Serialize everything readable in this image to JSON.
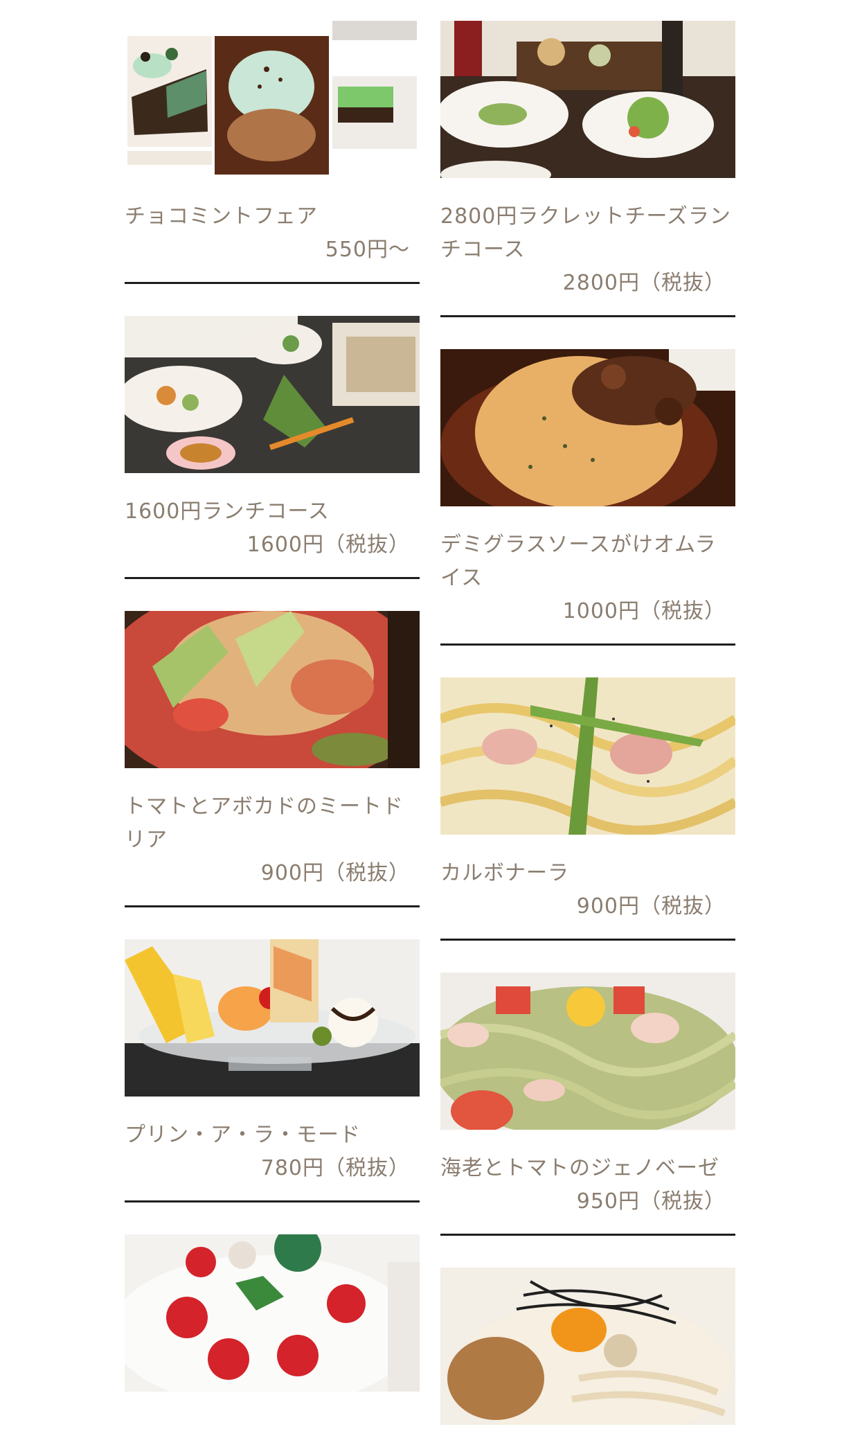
{
  "menu": {
    "left": [
      {
        "name": "チョコミントフェア",
        "price": "550円〜",
        "image_icon": "chocomint-desserts-photo"
      },
      {
        "name": "1600円ランチコース",
        "price": "1600円（税抜）",
        "image_icon": "lunch-course-photo"
      },
      {
        "name": "トマトとアボカドのミートドリア",
        "price": "900円（税抜）",
        "image_icon": "meat-doria-photo"
      },
      {
        "name": "プリン・ア・ラ・モード",
        "price": "780円（税抜）",
        "image_icon": "pudding-a-la-mode-photo"
      },
      {
        "name": "",
        "price": "",
        "image_icon": "christmas-cake-photo"
      }
    ],
    "right": [
      {
        "name": "2800円ラクレットチーズランチコース",
        "price": "2800円（税抜）",
        "image_icon": "raclette-lunch-photo"
      },
      {
        "name": "デミグラスソースがけオムライス",
        "price": "1000円（税抜）",
        "image_icon": "omurice-photo"
      },
      {
        "name": "カルボナーラ",
        "price": "900円（税抜）",
        "image_icon": "carbonara-photo"
      },
      {
        "name": "海老とトマトのジェノベーゼ",
        "price": "950円（税抜）",
        "image_icon": "shrimp-genovese-photo"
      },
      {
        "name": "",
        "price": "",
        "image_icon": "soba-noodle-photo"
      }
    ]
  },
  "colors": {
    "text": "#8a7d6f",
    "divider": "#1d1d1d",
    "background": "#ffffff"
  }
}
